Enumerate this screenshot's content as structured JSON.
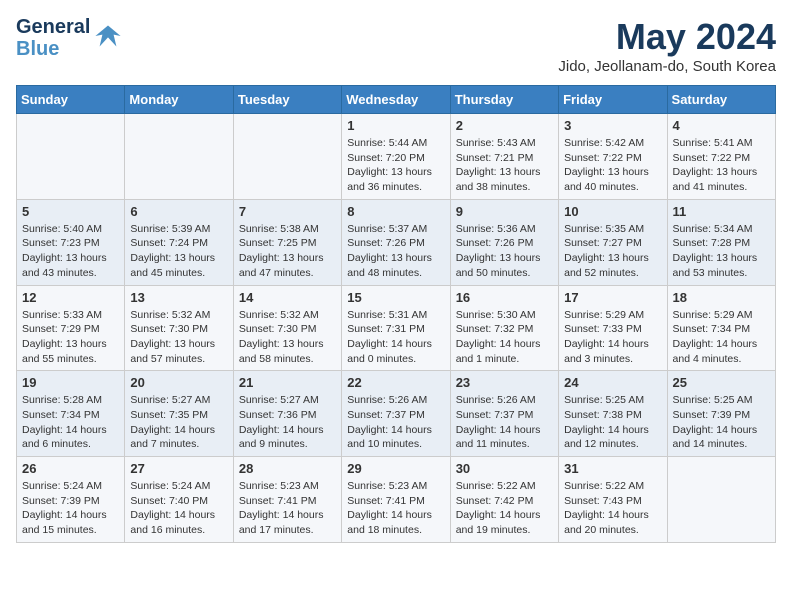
{
  "logo": {
    "line1": "General",
    "line2": "Blue"
  },
  "title": "May 2024",
  "location": "Jido, Jeollanam-do, South Korea",
  "days_of_week": [
    "Sunday",
    "Monday",
    "Tuesday",
    "Wednesday",
    "Thursday",
    "Friday",
    "Saturday"
  ],
  "weeks": [
    [
      {
        "day": "",
        "content": ""
      },
      {
        "day": "",
        "content": ""
      },
      {
        "day": "",
        "content": ""
      },
      {
        "day": "1",
        "content": "Sunrise: 5:44 AM\nSunset: 7:20 PM\nDaylight: 13 hours and 36 minutes."
      },
      {
        "day": "2",
        "content": "Sunrise: 5:43 AM\nSunset: 7:21 PM\nDaylight: 13 hours and 38 minutes."
      },
      {
        "day": "3",
        "content": "Sunrise: 5:42 AM\nSunset: 7:22 PM\nDaylight: 13 hours and 40 minutes."
      },
      {
        "day": "4",
        "content": "Sunrise: 5:41 AM\nSunset: 7:22 PM\nDaylight: 13 hours and 41 minutes."
      }
    ],
    [
      {
        "day": "5",
        "content": "Sunrise: 5:40 AM\nSunset: 7:23 PM\nDaylight: 13 hours and 43 minutes."
      },
      {
        "day": "6",
        "content": "Sunrise: 5:39 AM\nSunset: 7:24 PM\nDaylight: 13 hours and 45 minutes."
      },
      {
        "day": "7",
        "content": "Sunrise: 5:38 AM\nSunset: 7:25 PM\nDaylight: 13 hours and 47 minutes."
      },
      {
        "day": "8",
        "content": "Sunrise: 5:37 AM\nSunset: 7:26 PM\nDaylight: 13 hours and 48 minutes."
      },
      {
        "day": "9",
        "content": "Sunrise: 5:36 AM\nSunset: 7:26 PM\nDaylight: 13 hours and 50 minutes."
      },
      {
        "day": "10",
        "content": "Sunrise: 5:35 AM\nSunset: 7:27 PM\nDaylight: 13 hours and 52 minutes."
      },
      {
        "day": "11",
        "content": "Sunrise: 5:34 AM\nSunset: 7:28 PM\nDaylight: 13 hours and 53 minutes."
      }
    ],
    [
      {
        "day": "12",
        "content": "Sunrise: 5:33 AM\nSunset: 7:29 PM\nDaylight: 13 hours and 55 minutes."
      },
      {
        "day": "13",
        "content": "Sunrise: 5:32 AM\nSunset: 7:30 PM\nDaylight: 13 hours and 57 minutes."
      },
      {
        "day": "14",
        "content": "Sunrise: 5:32 AM\nSunset: 7:30 PM\nDaylight: 13 hours and 58 minutes."
      },
      {
        "day": "15",
        "content": "Sunrise: 5:31 AM\nSunset: 7:31 PM\nDaylight: 14 hours and 0 minutes."
      },
      {
        "day": "16",
        "content": "Sunrise: 5:30 AM\nSunset: 7:32 PM\nDaylight: 14 hours and 1 minute."
      },
      {
        "day": "17",
        "content": "Sunrise: 5:29 AM\nSunset: 7:33 PM\nDaylight: 14 hours and 3 minutes."
      },
      {
        "day": "18",
        "content": "Sunrise: 5:29 AM\nSunset: 7:34 PM\nDaylight: 14 hours and 4 minutes."
      }
    ],
    [
      {
        "day": "19",
        "content": "Sunrise: 5:28 AM\nSunset: 7:34 PM\nDaylight: 14 hours and 6 minutes."
      },
      {
        "day": "20",
        "content": "Sunrise: 5:27 AM\nSunset: 7:35 PM\nDaylight: 14 hours and 7 minutes."
      },
      {
        "day": "21",
        "content": "Sunrise: 5:27 AM\nSunset: 7:36 PM\nDaylight: 14 hours and 9 minutes."
      },
      {
        "day": "22",
        "content": "Sunrise: 5:26 AM\nSunset: 7:37 PM\nDaylight: 14 hours and 10 minutes."
      },
      {
        "day": "23",
        "content": "Sunrise: 5:26 AM\nSunset: 7:37 PM\nDaylight: 14 hours and 11 minutes."
      },
      {
        "day": "24",
        "content": "Sunrise: 5:25 AM\nSunset: 7:38 PM\nDaylight: 14 hours and 12 minutes."
      },
      {
        "day": "25",
        "content": "Sunrise: 5:25 AM\nSunset: 7:39 PM\nDaylight: 14 hours and 14 minutes."
      }
    ],
    [
      {
        "day": "26",
        "content": "Sunrise: 5:24 AM\nSunset: 7:39 PM\nDaylight: 14 hours and 15 minutes."
      },
      {
        "day": "27",
        "content": "Sunrise: 5:24 AM\nSunset: 7:40 PM\nDaylight: 14 hours and 16 minutes."
      },
      {
        "day": "28",
        "content": "Sunrise: 5:23 AM\nSunset: 7:41 PM\nDaylight: 14 hours and 17 minutes."
      },
      {
        "day": "29",
        "content": "Sunrise: 5:23 AM\nSunset: 7:41 PM\nDaylight: 14 hours and 18 minutes."
      },
      {
        "day": "30",
        "content": "Sunrise: 5:22 AM\nSunset: 7:42 PM\nDaylight: 14 hours and 19 minutes."
      },
      {
        "day": "31",
        "content": "Sunrise: 5:22 AM\nSunset: 7:43 PM\nDaylight: 14 hours and 20 minutes."
      },
      {
        "day": "",
        "content": ""
      }
    ]
  ]
}
